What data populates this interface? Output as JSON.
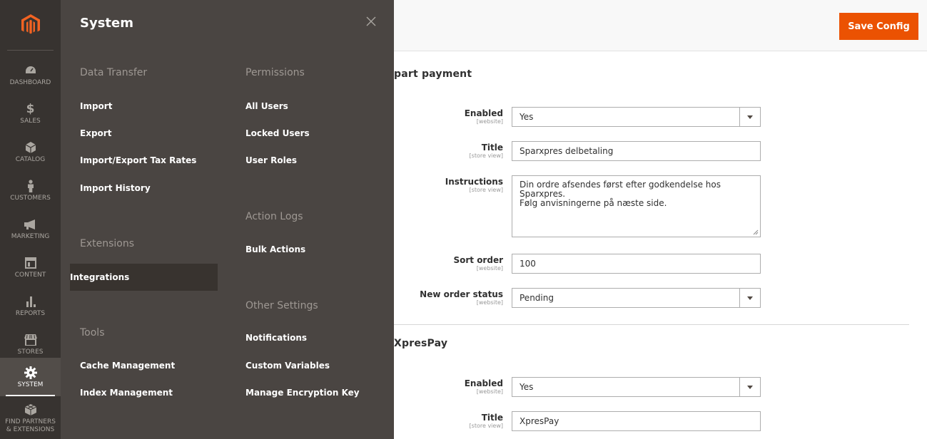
{
  "nav": {
    "items": [
      {
        "label": "DASHBOARD",
        "icon": "dashboard-icon"
      },
      {
        "label": "SALES",
        "icon": "dollar-icon"
      },
      {
        "label": "CATALOG",
        "icon": "box-icon"
      },
      {
        "label": "CUSTOMERS",
        "icon": "person-icon"
      },
      {
        "label": "MARKETING",
        "icon": "megaphone-icon"
      },
      {
        "label": "CONTENT",
        "icon": "layout-icon"
      },
      {
        "label": "REPORTS",
        "icon": "bar-chart-icon"
      },
      {
        "label": "STORES",
        "icon": "store-icon"
      },
      {
        "label": "SYSTEM",
        "icon": "gear-icon"
      },
      {
        "label_line1": "FIND PARTNERS",
        "label_line2": "& EXTENSIONS",
        "icon": "cube-icon"
      }
    ]
  },
  "panel": {
    "title": "System",
    "data_transfer": {
      "heading": "Data Transfer",
      "links": [
        "Import",
        "Export",
        "Import/Export Tax Rates",
        "Import History"
      ]
    },
    "extensions": {
      "heading": "Extensions",
      "links": [
        "Integrations"
      ]
    },
    "tools": {
      "heading": "Tools",
      "links": [
        "Cache Management",
        "Index Management"
      ]
    },
    "permissions": {
      "heading": "Permissions",
      "links": [
        "All Users",
        "Locked Users",
        "User Roles"
      ]
    },
    "action_logs": {
      "heading": "Action Logs",
      "links": [
        "Bulk Actions"
      ]
    },
    "other_settings": {
      "heading": "Other Settings",
      "links": [
        "Notifications",
        "Custom Variables",
        "Manage Encryption Key"
      ]
    }
  },
  "header": {
    "save_label": "Save Config"
  },
  "groups": [
    {
      "title": "part payment",
      "fields": {
        "enabled": {
          "label": "Enabled",
          "scope": "[website]",
          "value": "Yes"
        },
        "title": {
          "label": "Title",
          "scope": "[store view]",
          "value": "Sparxpres delbetaling"
        },
        "instructions": {
          "label": "Instructions",
          "scope": "[store view]",
          "line1": "Din ordre afsendes først efter godkendelse hos",
          "line2": "Sparxpres.",
          "line3": "Følg anvisningerne på næste side."
        },
        "sort_order": {
          "label": "Sort order",
          "scope": "[website]",
          "value": "100"
        },
        "new_order_status": {
          "label": "New order status",
          "scope": "[website]",
          "value": "Pending"
        }
      }
    },
    {
      "title": "XpresPay",
      "fields": {
        "enabled": {
          "label": "Enabled",
          "scope": "[website]",
          "value": "Yes"
        },
        "title": {
          "label": "Title",
          "scope": "[store view]",
          "value": "XpresPay"
        }
      }
    }
  ],
  "colors": {
    "accent": "#eb5202",
    "nav_bg": "#373330",
    "panel_bg": "#4a4542"
  }
}
